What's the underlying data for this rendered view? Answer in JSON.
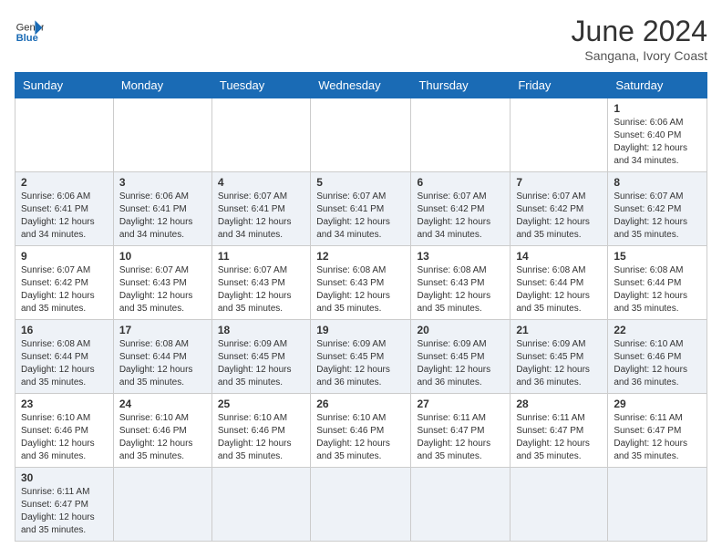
{
  "header": {
    "logo_general": "General",
    "logo_blue": "Blue",
    "title": "June 2024",
    "subtitle": "Sangana, Ivory Coast"
  },
  "days_of_week": [
    "Sunday",
    "Monday",
    "Tuesday",
    "Wednesday",
    "Thursday",
    "Friday",
    "Saturday"
  ],
  "weeks": [
    [
      null,
      null,
      null,
      null,
      null,
      null,
      {
        "day": 1,
        "sunrise": "6:06 AM",
        "sunset": "6:40 PM",
        "daylight": "12 hours and 34 minutes."
      }
    ],
    [
      {
        "day": 2,
        "sunrise": "6:06 AM",
        "sunset": "6:41 PM",
        "daylight": "12 hours and 34 minutes."
      },
      {
        "day": 3,
        "sunrise": "6:06 AM",
        "sunset": "6:41 PM",
        "daylight": "12 hours and 34 minutes."
      },
      {
        "day": 4,
        "sunrise": "6:07 AM",
        "sunset": "6:41 PM",
        "daylight": "12 hours and 34 minutes."
      },
      {
        "day": 5,
        "sunrise": "6:07 AM",
        "sunset": "6:41 PM",
        "daylight": "12 hours and 34 minutes."
      },
      {
        "day": 6,
        "sunrise": "6:07 AM",
        "sunset": "6:42 PM",
        "daylight": "12 hours and 34 minutes."
      },
      {
        "day": 7,
        "sunrise": "6:07 AM",
        "sunset": "6:42 PM",
        "daylight": "12 hours and 35 minutes."
      },
      {
        "day": 8,
        "sunrise": "6:07 AM",
        "sunset": "6:42 PM",
        "daylight": "12 hours and 35 minutes."
      }
    ],
    [
      {
        "day": 9,
        "sunrise": "6:07 AM",
        "sunset": "6:42 PM",
        "daylight": "12 hours and 35 minutes."
      },
      {
        "day": 10,
        "sunrise": "6:07 AM",
        "sunset": "6:43 PM",
        "daylight": "12 hours and 35 minutes."
      },
      {
        "day": 11,
        "sunrise": "6:07 AM",
        "sunset": "6:43 PM",
        "daylight": "12 hours and 35 minutes."
      },
      {
        "day": 12,
        "sunrise": "6:08 AM",
        "sunset": "6:43 PM",
        "daylight": "12 hours and 35 minutes."
      },
      {
        "day": 13,
        "sunrise": "6:08 AM",
        "sunset": "6:43 PM",
        "daylight": "12 hours and 35 minutes."
      },
      {
        "day": 14,
        "sunrise": "6:08 AM",
        "sunset": "6:44 PM",
        "daylight": "12 hours and 35 minutes."
      },
      {
        "day": 15,
        "sunrise": "6:08 AM",
        "sunset": "6:44 PM",
        "daylight": "12 hours and 35 minutes."
      }
    ],
    [
      {
        "day": 16,
        "sunrise": "6:08 AM",
        "sunset": "6:44 PM",
        "daylight": "12 hours and 35 minutes."
      },
      {
        "day": 17,
        "sunrise": "6:08 AM",
        "sunset": "6:44 PM",
        "daylight": "12 hours and 35 minutes."
      },
      {
        "day": 18,
        "sunrise": "6:09 AM",
        "sunset": "6:45 PM",
        "daylight": "12 hours and 35 minutes."
      },
      {
        "day": 19,
        "sunrise": "6:09 AM",
        "sunset": "6:45 PM",
        "daylight": "12 hours and 36 minutes."
      },
      {
        "day": 20,
        "sunrise": "6:09 AM",
        "sunset": "6:45 PM",
        "daylight": "12 hours and 36 minutes."
      },
      {
        "day": 21,
        "sunrise": "6:09 AM",
        "sunset": "6:45 PM",
        "daylight": "12 hours and 36 minutes."
      },
      {
        "day": 22,
        "sunrise": "6:10 AM",
        "sunset": "6:46 PM",
        "daylight": "12 hours and 36 minutes."
      }
    ],
    [
      {
        "day": 23,
        "sunrise": "6:10 AM",
        "sunset": "6:46 PM",
        "daylight": "12 hours and 36 minutes."
      },
      {
        "day": 24,
        "sunrise": "6:10 AM",
        "sunset": "6:46 PM",
        "daylight": "12 hours and 35 minutes."
      },
      {
        "day": 25,
        "sunrise": "6:10 AM",
        "sunset": "6:46 PM",
        "daylight": "12 hours and 35 minutes."
      },
      {
        "day": 26,
        "sunrise": "6:10 AM",
        "sunset": "6:46 PM",
        "daylight": "12 hours and 35 minutes."
      },
      {
        "day": 27,
        "sunrise": "6:11 AM",
        "sunset": "6:47 PM",
        "daylight": "12 hours and 35 minutes."
      },
      {
        "day": 28,
        "sunrise": "6:11 AM",
        "sunset": "6:47 PM",
        "daylight": "12 hours and 35 minutes."
      },
      {
        "day": 29,
        "sunrise": "6:11 AM",
        "sunset": "6:47 PM",
        "daylight": "12 hours and 35 minutes."
      }
    ],
    [
      {
        "day": 30,
        "sunrise": "6:11 AM",
        "sunset": "6:47 PM",
        "daylight": "12 hours and 35 minutes."
      },
      null,
      null,
      null,
      null,
      null,
      null
    ]
  ]
}
